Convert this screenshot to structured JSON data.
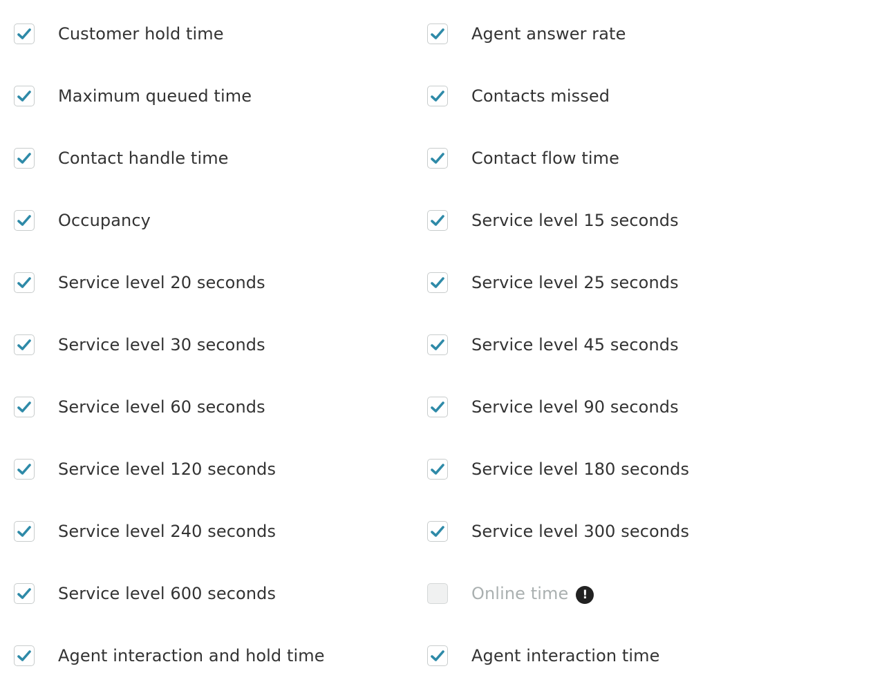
{
  "colors": {
    "check": "#2e8aa8",
    "label": "#333333",
    "label_disabled": "#aab0b0",
    "checkbox_border": "#c8cccc"
  },
  "metrics": [
    {
      "left": {
        "label": "Customer hold time",
        "checked": true
      },
      "right": {
        "label": "Agent answer rate",
        "checked": true
      }
    },
    {
      "left": {
        "label": "Maximum queued time",
        "checked": true
      },
      "right": {
        "label": "Contacts missed",
        "checked": true
      }
    },
    {
      "left": {
        "label": "Contact handle time",
        "checked": true
      },
      "right": {
        "label": "Contact flow time",
        "checked": true
      }
    },
    {
      "left": {
        "label": "Occupancy",
        "checked": true
      },
      "right": {
        "label": "Service level 15 seconds",
        "checked": true
      }
    },
    {
      "left": {
        "label": "Service level 20 seconds",
        "checked": true
      },
      "right": {
        "label": "Service level 25 seconds",
        "checked": true
      }
    },
    {
      "left": {
        "label": "Service level 30 seconds",
        "checked": true
      },
      "right": {
        "label": "Service level 45 seconds",
        "checked": true
      }
    },
    {
      "left": {
        "label": "Service level 60 seconds",
        "checked": true
      },
      "right": {
        "label": "Service level 90 seconds",
        "checked": true
      }
    },
    {
      "left": {
        "label": "Service level 120 seconds",
        "checked": true
      },
      "right": {
        "label": "Service level 180 seconds",
        "checked": true
      }
    },
    {
      "left": {
        "label": "Service level 240 seconds",
        "checked": true
      },
      "right": {
        "label": "Service level 300 seconds",
        "checked": true
      }
    },
    {
      "left": {
        "label": "Service level 600 seconds",
        "checked": true
      },
      "right": {
        "label": "Online time",
        "checked": false,
        "disabled": true,
        "icon": "warning-icon",
        "icon_glyph": "!"
      }
    },
    {
      "left": {
        "label": "Agent interaction and hold time",
        "checked": true
      },
      "right": {
        "label": "Agent interaction time",
        "checked": true
      }
    }
  ]
}
